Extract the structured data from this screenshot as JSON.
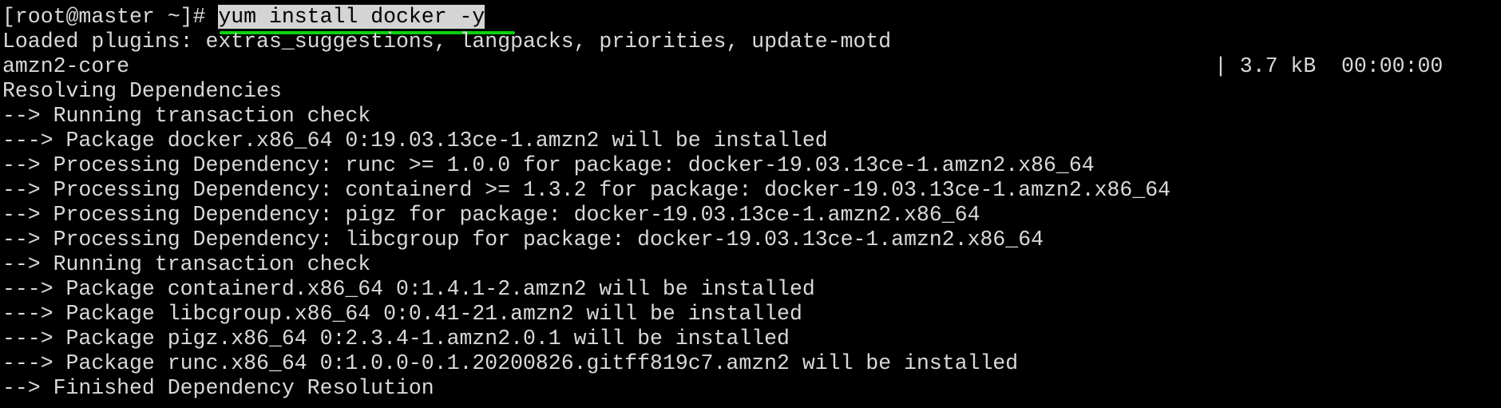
{
  "terminal": {
    "prompt": "[root@master ~]# ",
    "command": "yum install docker -y",
    "lines": [
      "Loaded plugins: extras_suggestions, langpacks, priorities, update-motd",
      "amzn2-core",
      "Resolving Dependencies",
      "--> Running transaction check",
      "---> Package docker.x86_64 0:19.03.13ce-1.amzn2 will be installed",
      "--> Processing Dependency: runc >= 1.0.0 for package: docker-19.03.13ce-1.amzn2.x86_64",
      "--> Processing Dependency: containerd >= 1.3.2 for package: docker-19.03.13ce-1.amzn2.x86_64",
      "--> Processing Dependency: pigz for package: docker-19.03.13ce-1.amzn2.x86_64",
      "--> Processing Dependency: libcgroup for package: docker-19.03.13ce-1.amzn2.x86_64",
      "--> Running transaction check",
      "---> Package containerd.x86_64 0:1.4.1-2.amzn2 will be installed",
      "---> Package libcgroup.x86_64 0:0.41-21.amzn2 will be installed",
      "---> Package pigz.x86_64 0:2.3.4-1.amzn2.0.1 will be installed",
      "---> Package runc.x86_64 0:1.0.0-0.1.20200826.gitff819c7.amzn2 will be installed",
      "--> Finished Dependency Resolution"
    ],
    "repo_status": "| 3.7 kB  00:00:00"
  },
  "colors": {
    "background": "#000000",
    "text": "#d9d9d9",
    "selection": "#d4d4d4",
    "annotation_underline": "#10d010"
  }
}
